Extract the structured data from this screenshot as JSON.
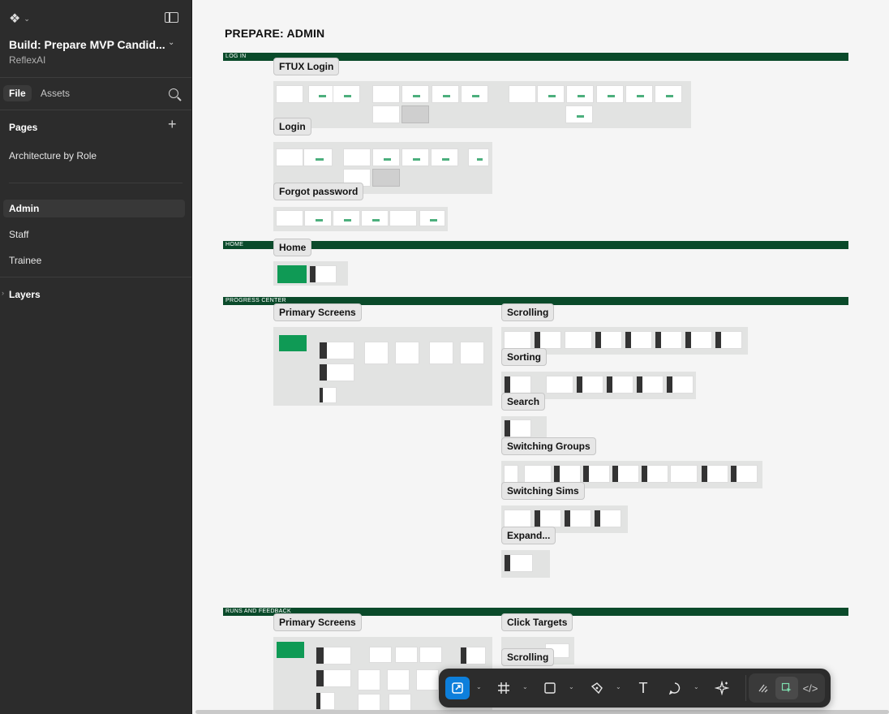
{
  "app": {
    "file_name": "Build: Prepare MVP Candid...",
    "team": "ReflexAI"
  },
  "sidebar": {
    "tabs": {
      "file": "File",
      "assets": "Assets"
    },
    "pages_label": "Pages",
    "pages": [
      "Architecture by Role",
      "Admin",
      "Staff",
      "Trainee"
    ],
    "active_page": "Admin",
    "layers_label": "Layers"
  },
  "canvas": {
    "page_title": "PREPARE: ADMIN",
    "sections": {
      "login": "LOG IN",
      "home": "HOME",
      "progress": "PROGRESS CENTER",
      "runs": "RUNS AND FEEDBACK"
    },
    "labels": {
      "ftux_login": "FTUX Login",
      "login": "Login",
      "forgot_password": "Forgot password",
      "home": "Home",
      "primary_screens": "Primary Screens",
      "scrolling": "Scrolling",
      "sorting": "Sorting",
      "search": "Search",
      "switching_groups": "Switching Groups",
      "switching_sims": "Switching Sims",
      "expand": "Expand...",
      "primary_screens_2": "Primary Screens",
      "click_targets": "Click Targets",
      "scrolling_2": "Scrolling"
    }
  },
  "toolbar": {
    "tools": [
      "move-tool",
      "frame-tool",
      "shape-tool",
      "pen-tool",
      "text-tool",
      "comment-tool",
      "actions-tool"
    ],
    "active_tool": "move-tool",
    "modes": [
      "draw-mode",
      "design-mode",
      "dev-mode"
    ],
    "active_mode": "design-mode"
  },
  "colors": {
    "sidebar_bg": "#2c2c2c",
    "section_bar": "#0a4a2a",
    "accent": "#0d7fdb",
    "green": "#0f9a55"
  }
}
